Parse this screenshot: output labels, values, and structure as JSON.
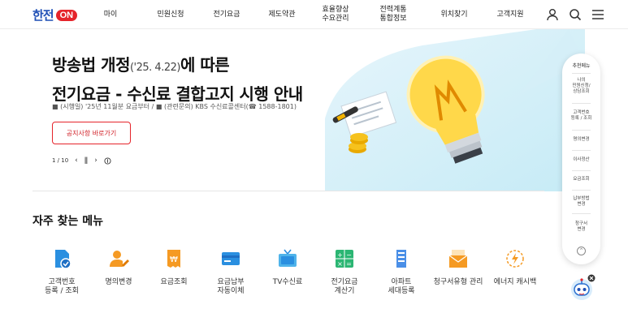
{
  "header": {
    "logo_text": "한전",
    "logo_on": "ON",
    "nav": [
      "마이",
      "민원신청",
      "전기요금",
      "제도약관",
      "효율향상\n수요관리",
      "전력계통\n통합정보",
      "위치찾기",
      "고객지원"
    ]
  },
  "hero": {
    "title_main": "방송법 개정",
    "title_sub": "('25. 4.22)",
    "title_tail": "에 따른",
    "title_line2": "전기요금 - 수신료 결합고지 시행 안내",
    "note": "■ (시행일) '25년 11월분 요금부터 / ■ (관련문의) KBS 수신료콜센터(☎ 1588-1801)",
    "button": "공지사항 바로가기",
    "pager": "1 / 10"
  },
  "frequent": {
    "title": "자주 찾는 메뉴",
    "items": [
      {
        "label": "고객번호\n등록 / 조회",
        "icon": "customer-number-icon"
      },
      {
        "label": "명의변경",
        "icon": "name-change-icon"
      },
      {
        "label": "요금조회",
        "icon": "bill-inquiry-icon"
      },
      {
        "label": "요금납부\n자동이체",
        "icon": "card-payment-icon"
      },
      {
        "label": "TV수신료",
        "icon": "tv-icon"
      },
      {
        "label": "전기요금\n계산기",
        "icon": "calculator-icon"
      },
      {
        "label": "아파트\n세대등록",
        "icon": "apartment-icon"
      },
      {
        "label": "청구서유형 관리",
        "icon": "envelope-icon"
      },
      {
        "label": "에너지 캐시백",
        "icon": "energy-cashback-icon"
      }
    ]
  },
  "quick": {
    "title": "추천메뉴",
    "items": [
      "나의\n민원신청/\n상담조회",
      "고객번호\n등록 / 조회",
      "명의변경",
      "이사정산",
      "요금조회",
      "납부방법\n변경",
      "청구서\n변경"
    ]
  },
  "colors": {
    "brand_blue": "#1f4fb5",
    "brand_red": "#e5242b",
    "icon_blue": "#2a8fe0",
    "icon_orange": "#f59a23"
  }
}
